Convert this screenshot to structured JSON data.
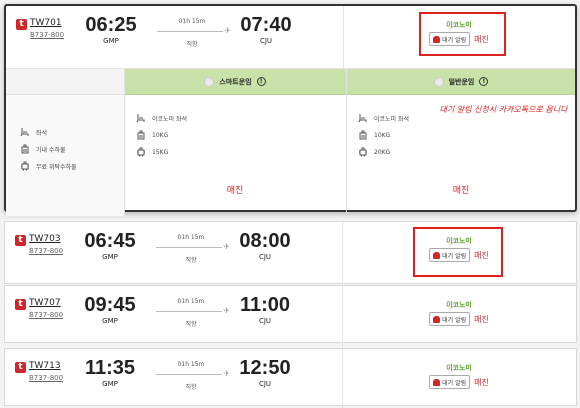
{
  "flights": [
    {
      "logo": "t",
      "flight_no": "TW701",
      "aircraft": "B737-800",
      "dep_time": "06:25",
      "dep_airport": "GMP",
      "duration": "01h 15m",
      "type": "직항",
      "arr_time": "07:40",
      "arr_airport": "CJU",
      "fare_class": "이코노미",
      "alert_label": "대기 알림",
      "status": "매진"
    },
    {
      "logo": "t",
      "flight_no": "TW703",
      "aircraft": "B737-800",
      "dep_time": "06:45",
      "dep_airport": "GMP",
      "duration": "01h 15m",
      "type": "직항",
      "arr_time": "08:00",
      "arr_airport": "CJU",
      "fare_class": "이코노미",
      "alert_label": "대기 알림",
      "status": "매진"
    },
    {
      "logo": "t",
      "flight_no": "TW707",
      "aircraft": "B737-800",
      "dep_time": "09:45",
      "dep_airport": "GMP",
      "duration": "01h 15m",
      "type": "직항",
      "arr_time": "11:00",
      "arr_airport": "CJU",
      "fare_class": "이코노미",
      "alert_label": "대기 알림",
      "status": "매진"
    },
    {
      "logo": "t",
      "flight_no": "TW713",
      "aircraft": "B737-800",
      "dep_time": "11:35",
      "dep_airport": "GMP",
      "duration": "01h 15m",
      "type": "직항",
      "arr_time": "12:50",
      "arr_airport": "CJU",
      "fare_class": "이코노미",
      "alert_label": "대기 알림",
      "status": "매진"
    }
  ],
  "detail": {
    "row_labels": [
      "좌석",
      "기내 수하물",
      "무료 위탁수하물"
    ],
    "fares": [
      {
        "name": "스마트운임",
        "info": "!",
        "seat": "이코노미 좌석",
        "cabin_bag": "10KG",
        "checked_bag": "15KG",
        "status": "매진"
      },
      {
        "name": "일반운임",
        "info": "!",
        "seat": "이코노미 좌석",
        "cabin_bag": "10KG",
        "checked_bag": "20KG",
        "status": "매진"
      }
    ],
    "note": "대기 알림 신청시 카카오톡으로 옵니다"
  },
  "colors": {
    "accent_red": "#d0262a",
    "annotation_red": "#e0221e",
    "fare_green": "#5aa02c",
    "fare_header_bg": "#c9e2a9"
  }
}
